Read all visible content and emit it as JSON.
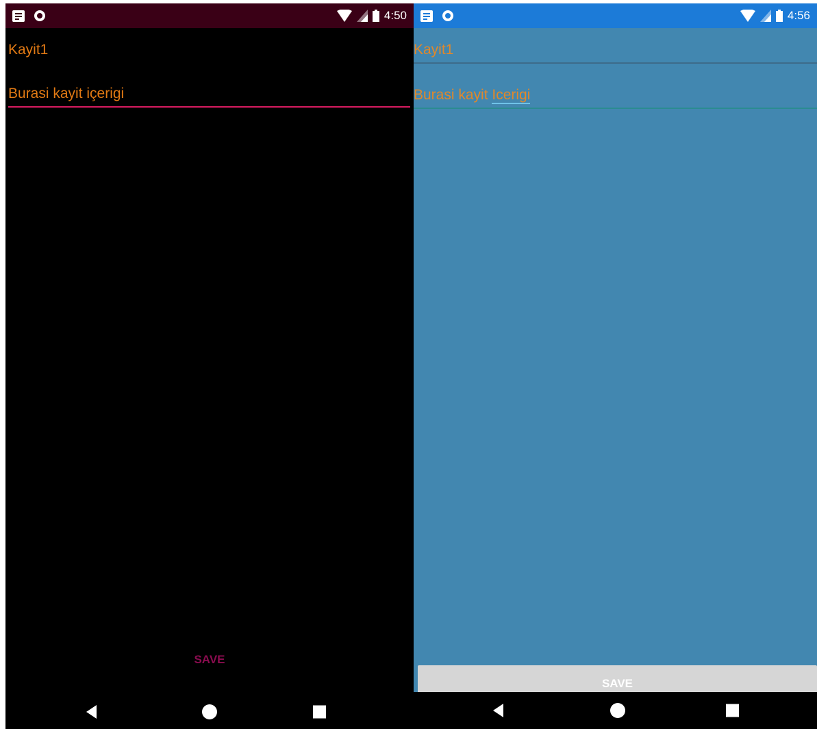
{
  "left_screen": {
    "status_bar": {
      "time": "4:50",
      "notification_icon": "notes-icon",
      "sync_icon": "circle-icon",
      "wifi_icon": "wifi-icon",
      "signal_icon": "signal-icon",
      "battery_icon": "battery-icon",
      "color": "#3a0016"
    },
    "title_field": {
      "value": "Kayit1"
    },
    "content_field": {
      "value": "Burasi kayit içerigi"
    },
    "save_button": {
      "label": "SAVE",
      "color": "#8a0c4f"
    },
    "background": "#000000",
    "accent": "#d81b60"
  },
  "right_screen": {
    "status_bar": {
      "time": "4:56",
      "notification_icon": "notes-icon",
      "sync_icon": "circle-icon",
      "wifi_icon": "wifi-icon",
      "signal_icon": "signal-icon",
      "battery_icon": "battery-icon",
      "color": "#1c7bd8"
    },
    "title_field": {
      "value": "Kayit1"
    },
    "content_field": {
      "value_prefix": "Burasi kayit ",
      "value_underlined": "Icerigi"
    },
    "save_button": {
      "label": "SAVE",
      "color": "#d6d6d6"
    },
    "background": "#4287b0"
  },
  "nav_bar": {
    "back_icon": "back-triangle-icon",
    "home_icon": "home-circle-icon",
    "recents_icon": "recents-square-icon"
  }
}
